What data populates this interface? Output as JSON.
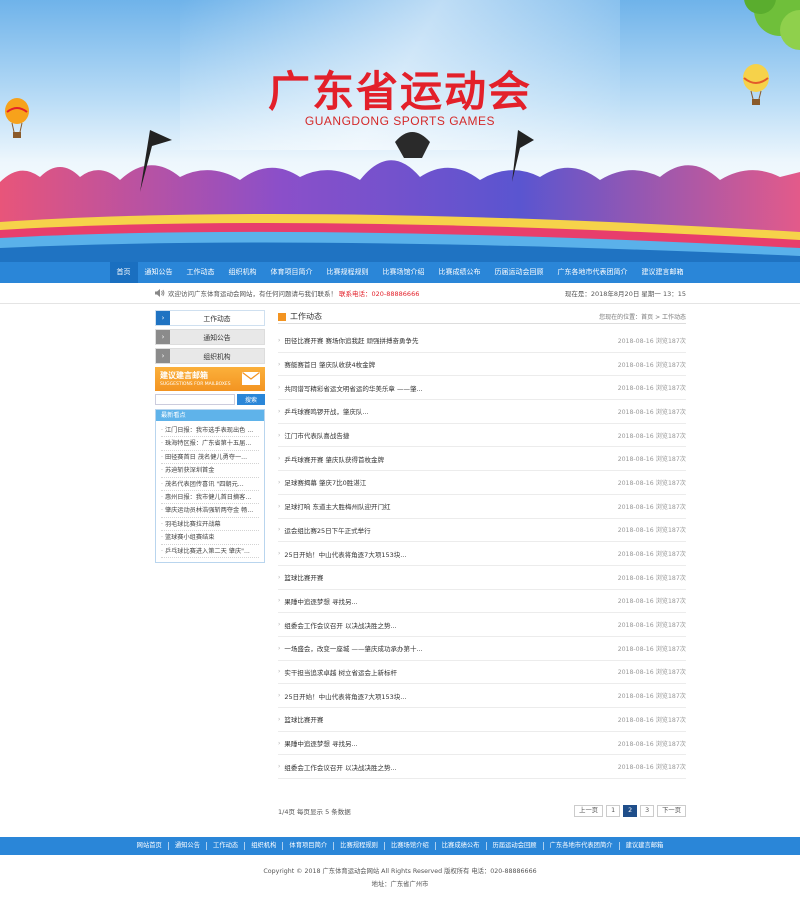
{
  "banner": {
    "title": "广东省运动会",
    "subtitle": "GUANGDONG SPORTS GAMES"
  },
  "nav": {
    "items": [
      "首页",
      "通知公告",
      "工作动态",
      "组织机构",
      "体育项目简介",
      "比赛规程规则",
      "比赛场馆介绍",
      "比赛成绩公布",
      "历届运动会回顾",
      "广东各地市代表团简介",
      "建议建言邮箱"
    ],
    "active": 0
  },
  "notice": {
    "welcome": "欢迎访问广东体育运动会网站，有任何问题请与我们联系！",
    "contact": "联系电话：020-88886666",
    "time": "现在是：2018年8月20日 星期一 13：15"
  },
  "sidebar": {
    "menu": [
      "工作动态",
      "通知公告",
      "组织机构"
    ],
    "active": 0,
    "mailbox_title": "建议建言邮箱",
    "mailbox_sub": "SUGGESTIONS FOR MAILBOXES",
    "search_placeholder": "",
    "search_button": "搜索",
    "news_title": "最新看点",
    "news": [
      "江门日报：我市选手表现出色 ...",
      "珠海特区报：广东省第十五届...",
      "田径赛首日 茂名健儿勇夺一...",
      "苏迪斩获深圳首金",
      "茂名代表团传喜讯 \"四朝元...",
      "惠州日报：我市健儿首日摘客...",
      "肇庆运动员林浩强斩两夺金 畅...",
      "羽毛球比赛拉开战幕",
      "篮球赛小组赛结束",
      "乒乓球比赛进入第二天 肇庆\"..."
    ]
  },
  "main": {
    "title": "工作动态",
    "breadcrumb": "您现在的位置：首页 > 工作动态",
    "items": [
      {
        "title": "田径比赛开赛 赛场你追我赶 顽强拼搏奋勇争先",
        "meta": "2018-08-16 浏览187次"
      },
      {
        "title": "赛艇赛首日 肇庆队收获4枚金牌",
        "meta": "2018-08-16 浏览187次"
      },
      {
        "title": "共同谱写精彩省运文明省运的华美乐章 ——肇...",
        "meta": "2018-08-16 浏览187次"
      },
      {
        "title": "乒乓球赛鸣锣开战，肇庆队...",
        "meta": "2018-08-16 浏览187次"
      },
      {
        "title": "江门市代表队喜战告捷",
        "meta": "2018-08-16 浏览187次"
      },
      {
        "title": "乒乓球赛开赛 肇庆队获得首枚金牌",
        "meta": "2018-08-16 浏览187次"
      },
      {
        "title": "足球赛揭幕 肇庆7比0胜湛江",
        "meta": "2018-08-16 浏览187次"
      },
      {
        "title": "足球打响 东道主大胜梅州队迎开门红",
        "meta": "2018-08-16 浏览187次"
      },
      {
        "title": "运会组比赛25日下午正式举行",
        "meta": "2018-08-16 浏览187次"
      },
      {
        "title": "25日开始！中山代表将角逐7大项153块...",
        "meta": "2018-08-16 浏览187次"
      },
      {
        "title": "篮球比赛开赛",
        "meta": "2018-08-16 浏览187次"
      },
      {
        "title": "果陲中追逐梦想 寻找另...",
        "meta": "2018-08-16 浏览187次"
      },
      {
        "title": "组委会工作会议召开 以决战决胜之势...",
        "meta": "2018-08-16 浏览187次"
      },
      {
        "title": "一场盛会，改变一座城 ——肇庆成功承办第十...",
        "meta": "2018-08-16 浏览187次"
      },
      {
        "title": "实干担当追求卓越 树立省运会上新标杆",
        "meta": "2018-08-16 浏览187次"
      },
      {
        "title": "25日开始！中山代表将角逐7大项153块...",
        "meta": "2018-08-16 浏览187次"
      },
      {
        "title": "篮球比赛开赛",
        "meta": "2018-08-16 浏览187次"
      },
      {
        "title": "果陲中追逐梦想 寻找另...",
        "meta": "2018-08-16 浏览187次"
      },
      {
        "title": "组委会工作会议召开 以决战决胜之势...",
        "meta": "2018-08-16 浏览187次"
      }
    ]
  },
  "pager": {
    "info": "1/4页 每页显示 5 条数据",
    "prev": "上一页",
    "pages": [
      "1",
      "2",
      "3"
    ],
    "current": 1,
    "next": "下一页"
  },
  "footer": {
    "nav": [
      "网站首页",
      "通知公告",
      "工作动态",
      "组织机构",
      "体育项目简介",
      "比赛规程规则",
      "比赛场馆介绍",
      "比赛成绩公布",
      "历届运动会回顾",
      "广东各地市代表团简介",
      "建议建言邮箱"
    ],
    "copyright": "Copyright © 2018 广东体育运动会网站 All Rights Reserved 版权所有 电话：020-88886666",
    "address": "地址：广东省广州市"
  },
  "colors": {
    "nav_blue": "#2a86d8",
    "title_red": "#e3202a",
    "accent_orange": "#f39421"
  }
}
